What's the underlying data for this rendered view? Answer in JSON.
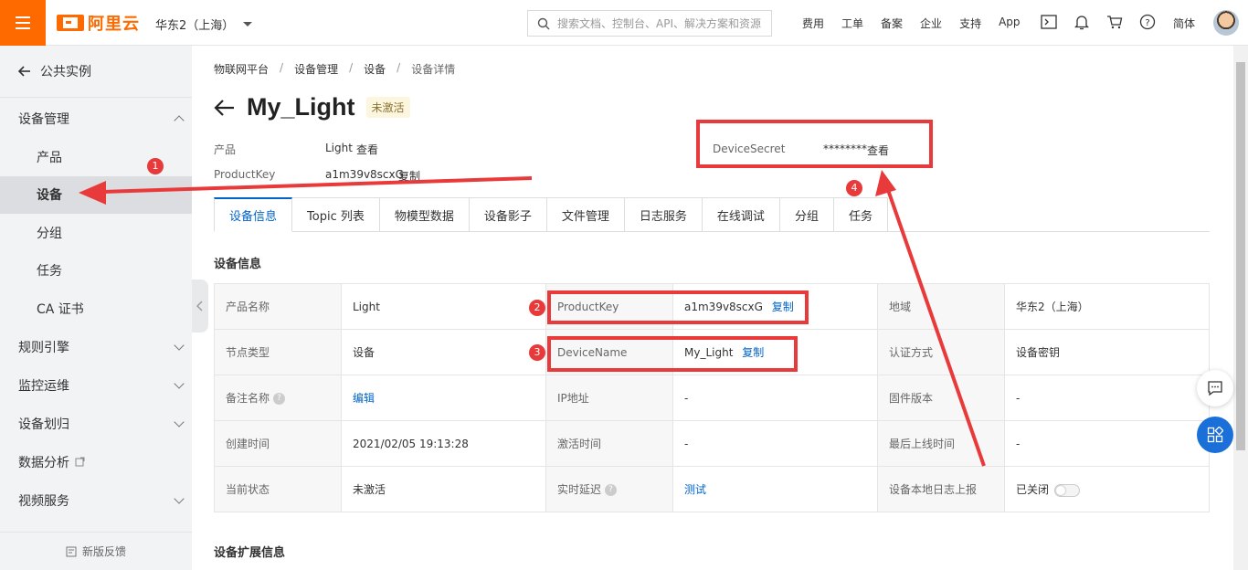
{
  "topbar": {
    "logo_text": "阿里云",
    "region": "华东2（上海）",
    "search_placeholder": "搜索文档、控制台、API、解决方案和资源",
    "links": [
      "费用",
      "工单",
      "备案",
      "企业",
      "支持",
      "App"
    ],
    "lang": "简体"
  },
  "sidebar": {
    "back_label": "公共实例",
    "group_device": "设备管理",
    "sub_items": [
      "产品",
      "设备",
      "分组",
      "任务",
      "CA 证书"
    ],
    "groups": [
      "规则引擎",
      "监控运维",
      "设备划归",
      "数据分析",
      "视频服务"
    ],
    "feedback": "新版反馈"
  },
  "breadcrumb": [
    "物联网平台",
    "设备管理",
    "设备",
    "设备详情"
  ],
  "device": {
    "title": "My_Light",
    "status": "未激活",
    "product_label": "产品",
    "product_value": "Light",
    "view_link": "查看",
    "productkey_label": "ProductKey",
    "productkey_value": "a1m39v8scxG",
    "copy_link": "复制",
    "secret_label": "DeviceSecret",
    "secret_value": "********"
  },
  "tabs": [
    "设备信息",
    "Topic 列表",
    "物模型数据",
    "设备影子",
    "文件管理",
    "日志服务",
    "在线调试",
    "分组",
    "任务"
  ],
  "section_titles": {
    "info": "设备信息",
    "ext": "设备扩展信息"
  },
  "info_table": {
    "r1": {
      "k1": "产品名称",
      "v1": "Light",
      "k2": "ProductKey",
      "v2": "a1m39v8scxG",
      "k3": "地域",
      "v3": "华东2（上海）"
    },
    "r2": {
      "k1": "节点类型",
      "v1": "设备",
      "k2": "DeviceName",
      "v2": "My_Light",
      "k3": "认证方式",
      "v3": "设备密钥"
    },
    "r3": {
      "k1": "备注名称",
      "v1": "编辑",
      "k2": "IP地址",
      "v2": "-",
      "k3": "固件版本",
      "v3": "-"
    },
    "r4": {
      "k1": "创建时间",
      "v1": "2021/02/05 19:13:28",
      "k2": "激活时间",
      "v2": "-",
      "k3": "最后上线时间",
      "v3": "-"
    },
    "r5": {
      "k1": "当前状态",
      "v1": "未激活",
      "k2": "实时延迟",
      "v2": "测试",
      "k3": "设备本地日志上报",
      "v3": "已关闭"
    },
    "copy": "复制"
  },
  "annotations": [
    "1",
    "2",
    "3",
    "4"
  ],
  "colors": {
    "brand": "#ff6a00",
    "link": "#0064c8",
    "annotation": "#e83a3a"
  }
}
